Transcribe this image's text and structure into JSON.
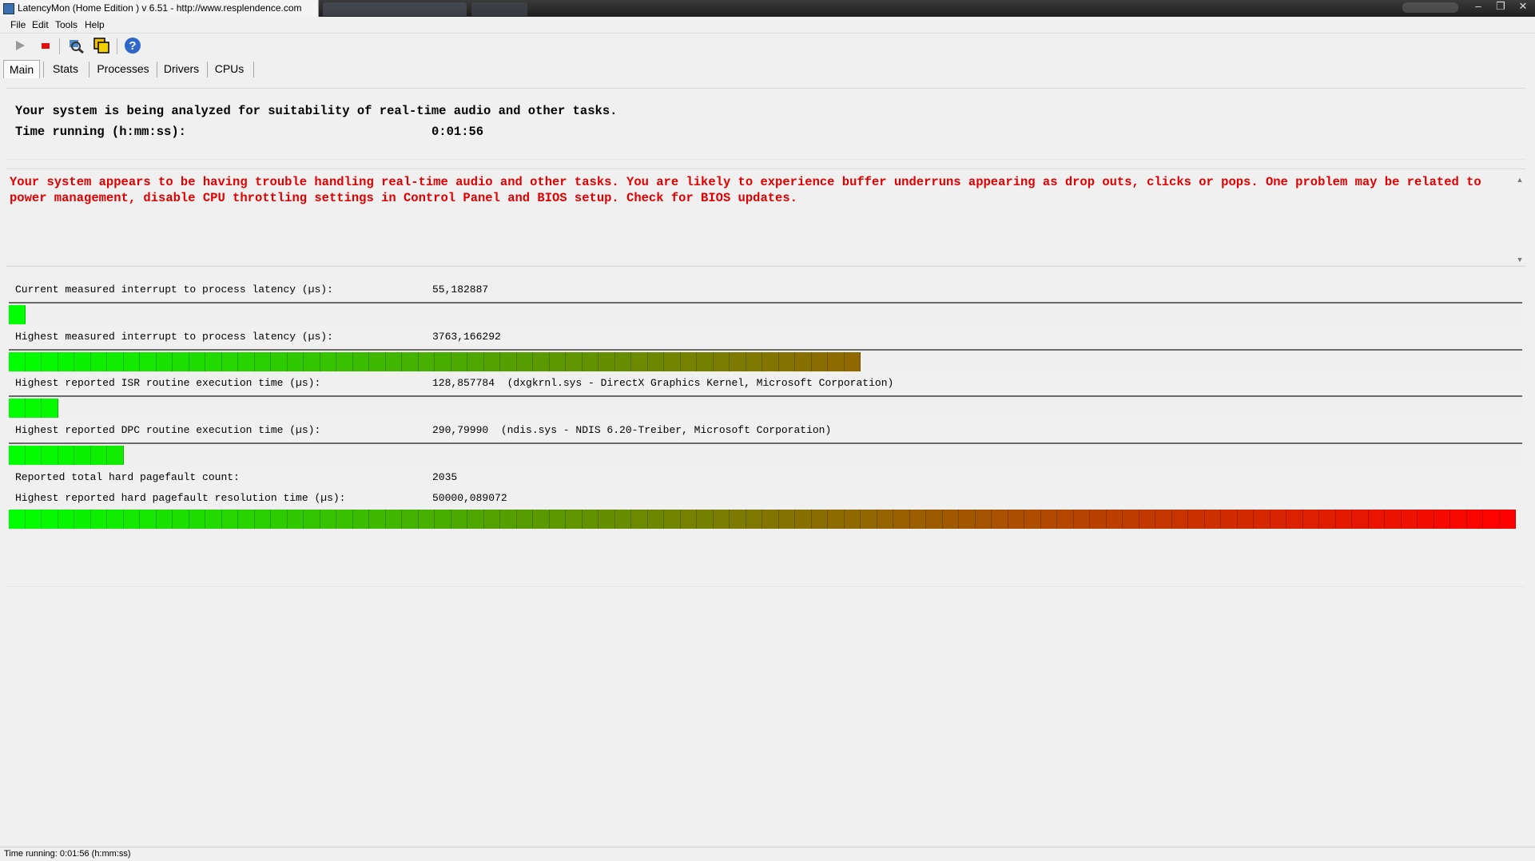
{
  "window": {
    "title": "LatencyMon  (Home Edition )  v 6.51 - http://www.resplendence.com"
  },
  "menu": [
    "File",
    "Edit",
    "Tools",
    "Help"
  ],
  "toolbar": {
    "icons": [
      "play-icon",
      "stop-icon",
      "search-drivers-icon",
      "windows-icon",
      "help-icon"
    ]
  },
  "tabs": [
    "Main",
    "Stats",
    "Processes",
    "Drivers",
    "CPUs"
  ],
  "active_tab": "Main",
  "header": {
    "line1": "Your system is being analyzed for suitability of real-time audio and other tasks.",
    "time_label": "Time running (h:mm:ss):",
    "time_value": "0:01:56"
  },
  "warning": {
    "text": "Your system appears to be having trouble handling real-time audio and other tasks. You are likely to experience buffer underruns appearing as drop outs, clicks or pops. One problem may be related to power management, disable CPU throttling settings in Control Panel and BIOS setup. Check for BIOS updates.",
    "color": "#e00000"
  },
  "metrics": {
    "current_latency": {
      "label": "Current measured interrupt to process latency (µs):",
      "value": "55,182887",
      "level": 0.009
    },
    "highest_latency": {
      "label": "Highest measured interrupt to process latency (µs):",
      "value": "3763,166292",
      "level": 0.565
    },
    "isr": {
      "label": "Highest reported ISR routine execution time (µs):",
      "value": "128,857784  (dxgkrnl.sys - DirectX Graphics Kernel, Microsoft Corporation)",
      "level": 0.034
    },
    "dpc": {
      "label": "Highest reported DPC routine execution time (µs):",
      "value": "290,79990  (ndis.sys - NDIS 6.20-Treiber, Microsoft Corporation)",
      "level": 0.08
    },
    "pagefault_count": {
      "label": "Reported total hard pagefault count:",
      "value": "2035"
    },
    "pagefault_time": {
      "label": "Highest reported hard pagefault resolution time (µs):",
      "value": "50000,089072",
      "level": 1.0
    }
  },
  "gauge_colors": {
    "start": "#00ff00",
    "mid": "#5a9a00",
    "end": "#ff0000"
  },
  "status_bar": {
    "text": "Time running: 0:01:56  (h:mm:ss)"
  }
}
